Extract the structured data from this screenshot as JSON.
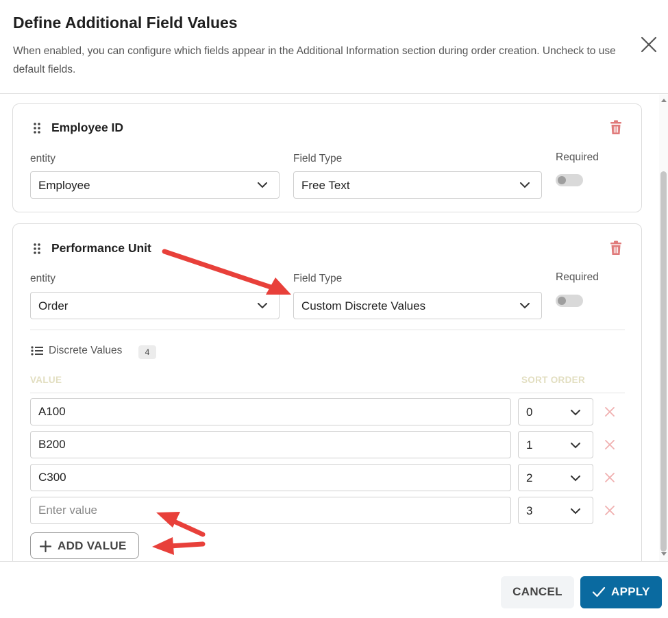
{
  "dialog": {
    "title": "Define Additional Field Values",
    "description": "When enabled, you can configure which fields appear in the Additional Information section during order creation. Uncheck to use default fields."
  },
  "labels": {
    "entity": "entity",
    "field_type": "Field Type",
    "required": "Required"
  },
  "fields": [
    {
      "title": "Employee ID",
      "entity": "Employee",
      "field_type": "Free Text",
      "required": false
    },
    {
      "title": "Performance Unit",
      "entity": "Order",
      "field_type": "Custom Discrete Values",
      "required": false
    }
  ],
  "discrete_values": {
    "label": "Discrete Values",
    "count": "4",
    "col_value": "VALUE",
    "col_sort": "SORT ORDER",
    "rows": [
      {
        "value": "A100",
        "sort": "0"
      },
      {
        "value": "B200",
        "sort": "1"
      },
      {
        "value": "C300",
        "sort": "2"
      },
      {
        "value": "",
        "sort": "3"
      }
    ],
    "placeholder": "Enter value",
    "add_label": "ADD VALUE"
  },
  "footer": {
    "cancel_label": "CANCEL",
    "apply_label": "APPLY"
  },
  "colors": {
    "primary": "#0a6aa0",
    "danger": "#e07a7a",
    "annotation_arrow": "#e8403a",
    "column_header": "#e2dec0"
  },
  "icons": [
    "close-icon",
    "drag-handle-icon",
    "trash-icon",
    "chevron-down-icon",
    "list-icon",
    "remove-x-icon",
    "plus-icon",
    "check-icon"
  ]
}
